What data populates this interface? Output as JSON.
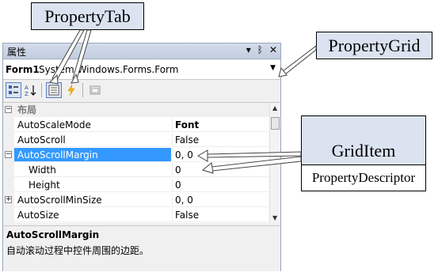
{
  "callouts": {
    "property_tab": "PropertyTab",
    "property_grid": "PropertyGrid",
    "grid_item": "GridItem",
    "property_descriptor": "PropertyDescriptor"
  },
  "panel": {
    "title": "属性",
    "title_icons": [
      "▾",
      "ᛒ",
      "✕"
    ],
    "object_name": "Form1",
    "object_type": "System.Windows.Forms.Form",
    "object_dropdown": "▼"
  },
  "toolbar": {
    "categorized_icon": "categorized-icon",
    "alphabetical_icon": "alphabetical-icon",
    "properties_icon": "properties-icon",
    "events_icon": "events-icon",
    "property_pages_icon": "property-pages-icon"
  },
  "grid": {
    "category": {
      "expander": "⊟",
      "label": "布局"
    },
    "rows": [
      {
        "name": "AutoScaleMode",
        "value": "Font",
        "bold": true
      },
      {
        "name": "AutoScroll",
        "value": "False"
      },
      {
        "name": "AutoScrollMargin",
        "value": "0, 0",
        "expander": "−",
        "selected": true
      },
      {
        "name": "Width",
        "value": "0",
        "sub": true
      },
      {
        "name": "Height",
        "value": "0",
        "sub": true
      },
      {
        "name": "AutoScrollMinSize",
        "value": "0, 0",
        "expander": "+"
      },
      {
        "name": "AutoSize",
        "value": "False"
      }
    ]
  },
  "description": {
    "title": "AutoScrollMargin",
    "text": "自动滚动过程中控件周围的边距。"
  },
  "colors": {
    "selection": "#3399ff",
    "callout_fill": "#dbe3f1"
  }
}
